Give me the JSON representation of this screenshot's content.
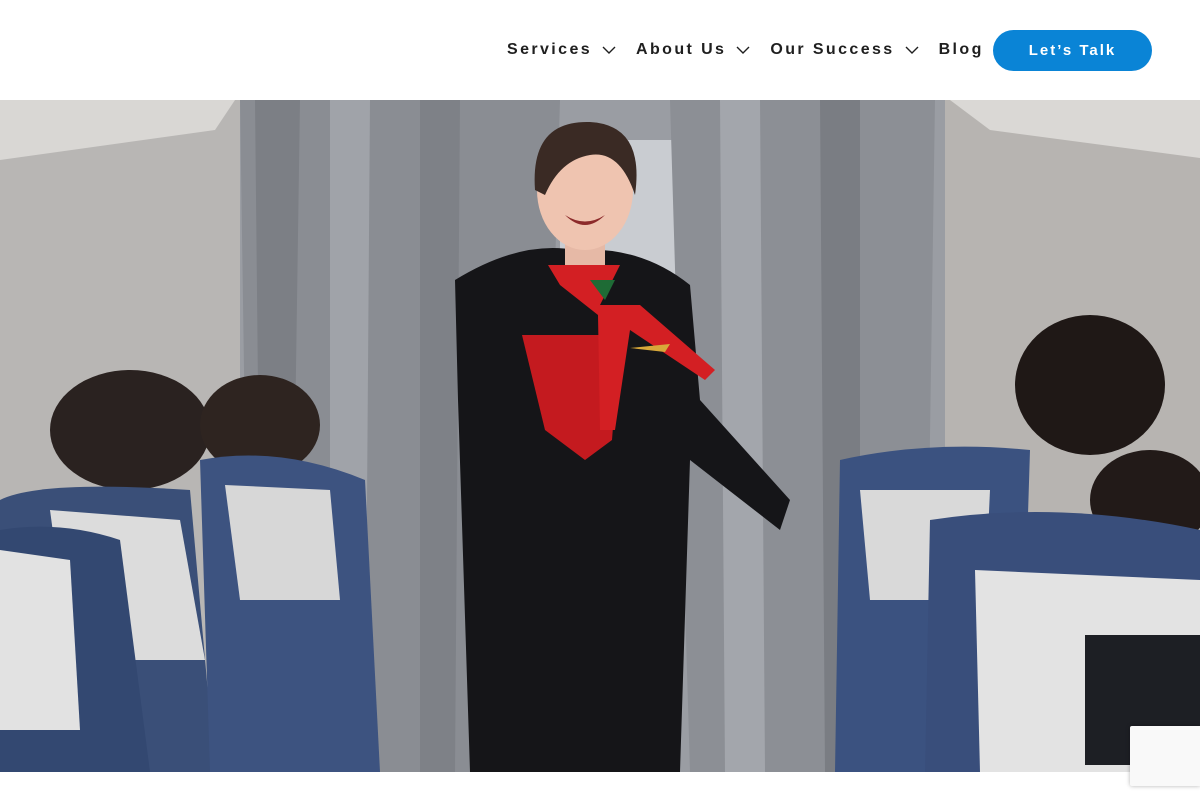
{
  "nav": {
    "items": [
      {
        "label": "Services",
        "has_dropdown": true
      },
      {
        "label": "About Us",
        "has_dropdown": true
      },
      {
        "label": "Our Success",
        "has_dropdown": true
      },
      {
        "label": "Blog",
        "has_dropdown": false
      }
    ],
    "cta_label": "Let’s Talk"
  },
  "icons": {
    "dropdown": "chevron-down-icon"
  },
  "colors": {
    "accent": "#0a84d6",
    "nav_text": "#1f1f1f",
    "background": "#ffffff"
  }
}
